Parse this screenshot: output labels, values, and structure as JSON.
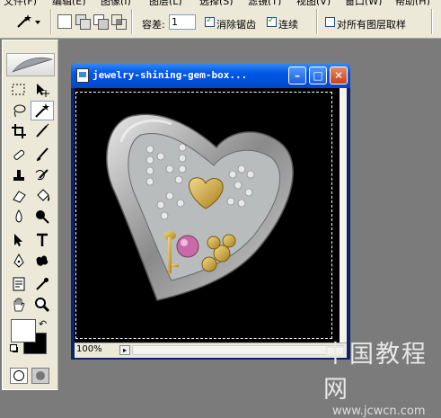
{
  "menubar": {
    "items": [
      "文件(F)",
      "编辑(E)",
      "图像(I)",
      "图层(L)",
      "选择(S)",
      "滤镜(T)",
      "视图(V)",
      "窗口(W)",
      "帮助(H)"
    ]
  },
  "options": {
    "tolerance_label": "容差:",
    "tolerance_value": "1",
    "anti_alias_label": "消除锯齿",
    "anti_alias_checked": true,
    "contiguous_label": "连续",
    "contiguous_checked": true,
    "sample_all_label": "对所有图层取样",
    "sample_all_checked": false
  },
  "document": {
    "title": "jewelry-shining-gem-box...",
    "zoom": "100%"
  },
  "watermark": {
    "title": "中国教程网",
    "url": "www.jcwcn.com"
  },
  "tools": [
    "rect-marquee",
    "move",
    "lasso",
    "magic-wand",
    "crop",
    "slice",
    "healing-brush",
    "brush",
    "clone-stamp",
    "history-brush",
    "eraser",
    "paint-bucket",
    "blur",
    "dodge",
    "path-select",
    "type",
    "pen",
    "custom-shape",
    "notes",
    "eyedropper",
    "hand",
    "zoom"
  ]
}
